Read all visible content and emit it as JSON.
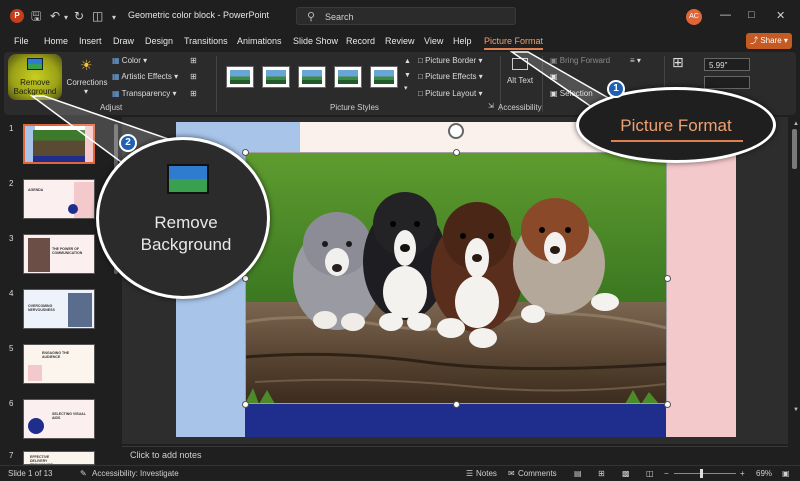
{
  "window": {
    "title": "Geometric color block  -  PowerPoint",
    "search_placeholder": "Search",
    "avatar_initials": "AC",
    "app_logo": "P"
  },
  "menu": {
    "tabs": [
      "File",
      "Home",
      "Insert",
      "Draw",
      "Design",
      "Transitions",
      "Animations",
      "Slide Show",
      "Record",
      "Review",
      "View",
      "Help",
      "Picture Format"
    ],
    "active_tab": "Picture Format",
    "share_label": "Share"
  },
  "ribbon": {
    "adjust": {
      "label": "Adjust",
      "remove_background": "Remove Background",
      "corrections": "Corrections",
      "color": "Color",
      "artistic_effects": "Artistic Effects",
      "transparency": "Transparency"
    },
    "picture_styles": {
      "label": "Picture Styles",
      "border": "Picture Border",
      "effects": "Picture Effects",
      "layout": "Picture Layout"
    },
    "accessibility": {
      "label": "Accessibility",
      "alt_text": "Alt Text"
    },
    "arrange": {
      "bring_forward": "Bring Forward",
      "selection": "Selection"
    },
    "size": {
      "value": "5.99\""
    }
  },
  "callouts": {
    "badge_1": "1",
    "badge_2": "2",
    "zoom_picture_format": "Picture Format",
    "zoom_remove_background": "Remove Background"
  },
  "slides": {
    "numbers": [
      "1",
      "2",
      "3",
      "4",
      "5",
      "6",
      "7"
    ],
    "titles": [
      "",
      "AGENDA",
      "THE POWER OF COMMUNICATION",
      "OVERCOMING NERVOUSNESS",
      "ENGAGING THE AUDIENCE",
      "SELECTING VISUAL AIDS",
      "EFFECTIVE DELIVERY TECHNIQUES"
    ]
  },
  "notes": {
    "placeholder": "Click to add notes"
  },
  "status": {
    "slide_of": "Slide 1 of 13",
    "accessibility": "Accessibility: Investigate",
    "notes": "Notes",
    "comments": "Comments",
    "zoom": "69%"
  },
  "colors": {
    "accent": "#e0663a",
    "active_tab": "#f0a070",
    "slide_blue": "#a8c4e8",
    "slide_pink": "#f4c9cc",
    "slide_navy": "#1f2e8c",
    "badge": "#1f5fb4"
  }
}
